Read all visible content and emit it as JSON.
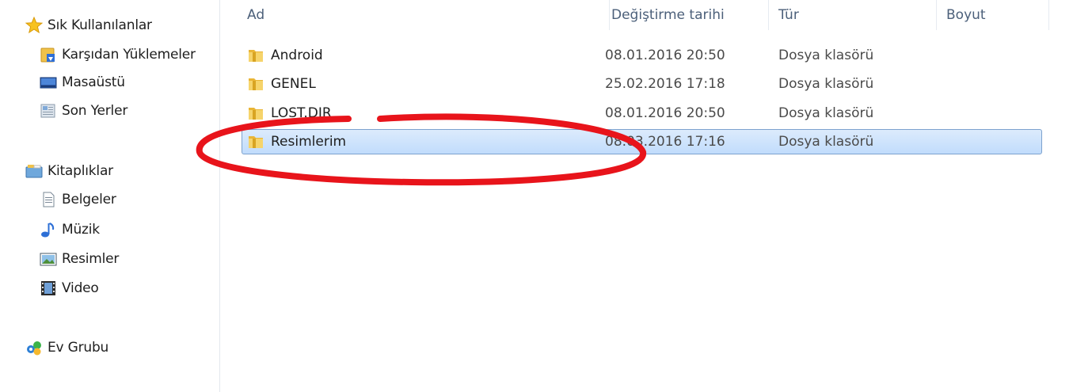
{
  "nav": {
    "favorites": {
      "label": "Sık Kullanılanlar",
      "icon": "star-icon"
    },
    "favorite_items": [
      {
        "label": "Karşıdan Yüklemeler",
        "icon": "downloads-folder-icon"
      },
      {
        "label": "Masaüstü",
        "icon": "desktop-icon"
      },
      {
        "label": "Son Yerler",
        "icon": "recent-places-icon"
      }
    ],
    "libraries": {
      "label": "Kitaplıklar",
      "icon": "libraries-icon"
    },
    "library_items": [
      {
        "label": "Belgeler",
        "icon": "document-icon"
      },
      {
        "label": "Müzik",
        "icon": "music-note-icon"
      },
      {
        "label": "Resimler",
        "icon": "pictures-icon"
      },
      {
        "label": "Video",
        "icon": "video-film-icon"
      }
    ],
    "homegroup": {
      "label": "Ev Grubu",
      "icon": "homegroup-icon"
    }
  },
  "columns": [
    "Ad",
    "Değiştirme tarihi",
    "Tür",
    "Boyut"
  ],
  "files": [
    {
      "name": "Android",
      "date": "08.01.2016 20:50",
      "type": "Dosya klasörü",
      "size": "",
      "selected": false
    },
    {
      "name": "GENEL",
      "date": "25.02.2016 17:18",
      "type": "Dosya klasörü",
      "size": "",
      "selected": false
    },
    {
      "name": "LOST.DIR",
      "date": "08.01.2016 20:50",
      "type": "Dosya klasörü",
      "size": "",
      "selected": false
    },
    {
      "name": "Resimlerim",
      "date": "08.03.2016 17:16",
      "type": "Dosya klasörü",
      "size": "",
      "selected": true
    }
  ],
  "colors": {
    "selection": "#c1dcfc",
    "selection_border": "#7da2ce",
    "annotation": "#e8141b",
    "folder": "#f2c94c"
  }
}
